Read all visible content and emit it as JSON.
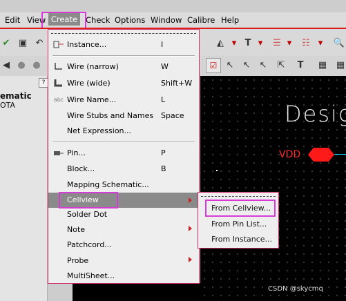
{
  "menubar": {
    "items": [
      "Edit",
      "View",
      "Create",
      "Check",
      "Options",
      "Window",
      "Calibre",
      "Help"
    ]
  },
  "dropdown": {
    "items": [
      {
        "label": "Instance...",
        "key": "I",
        "icon": "instance-icon"
      },
      {
        "label": "Wire (narrow)",
        "key": "W",
        "icon": "wire-narrow-icon"
      },
      {
        "label": "Wire (wide)",
        "key": "Shift+W",
        "icon": "wire-wide-icon"
      },
      {
        "label": "Wire Name...",
        "key": "L",
        "icon": "wire-name-icon"
      },
      {
        "label": "Wire Stubs and Names",
        "key": "Space"
      },
      {
        "label": "Net Expression..."
      },
      {
        "label": "Pin...",
        "key": "P",
        "icon": "pin-icon"
      },
      {
        "label": "Block...",
        "key": "B"
      },
      {
        "label": "Mapping Schematic..."
      },
      {
        "label": "Cellview",
        "submenu": true
      },
      {
        "label": "Solder Dot"
      },
      {
        "label": "Note",
        "submenu": true
      },
      {
        "label": "Patchcord..."
      },
      {
        "label": "Probe",
        "submenu": true
      },
      {
        "label": "MultiSheet..."
      }
    ]
  },
  "submenu": {
    "items": [
      "From Cellview...",
      "From Pin List...",
      "From Instance..."
    ]
  },
  "left_panel": {
    "title": "ematic",
    "subtitle": "OTA"
  },
  "canvas": {
    "design_text": "Desig",
    "vdd_label": "VDD"
  },
  "watermark": "CSDN @skycmq",
  "colors": {
    "highlight": "#d63bd6",
    "menu_selected": "#8a8a8a",
    "pin_red": "#ff1a1a",
    "canvas_bg": "#000000"
  }
}
